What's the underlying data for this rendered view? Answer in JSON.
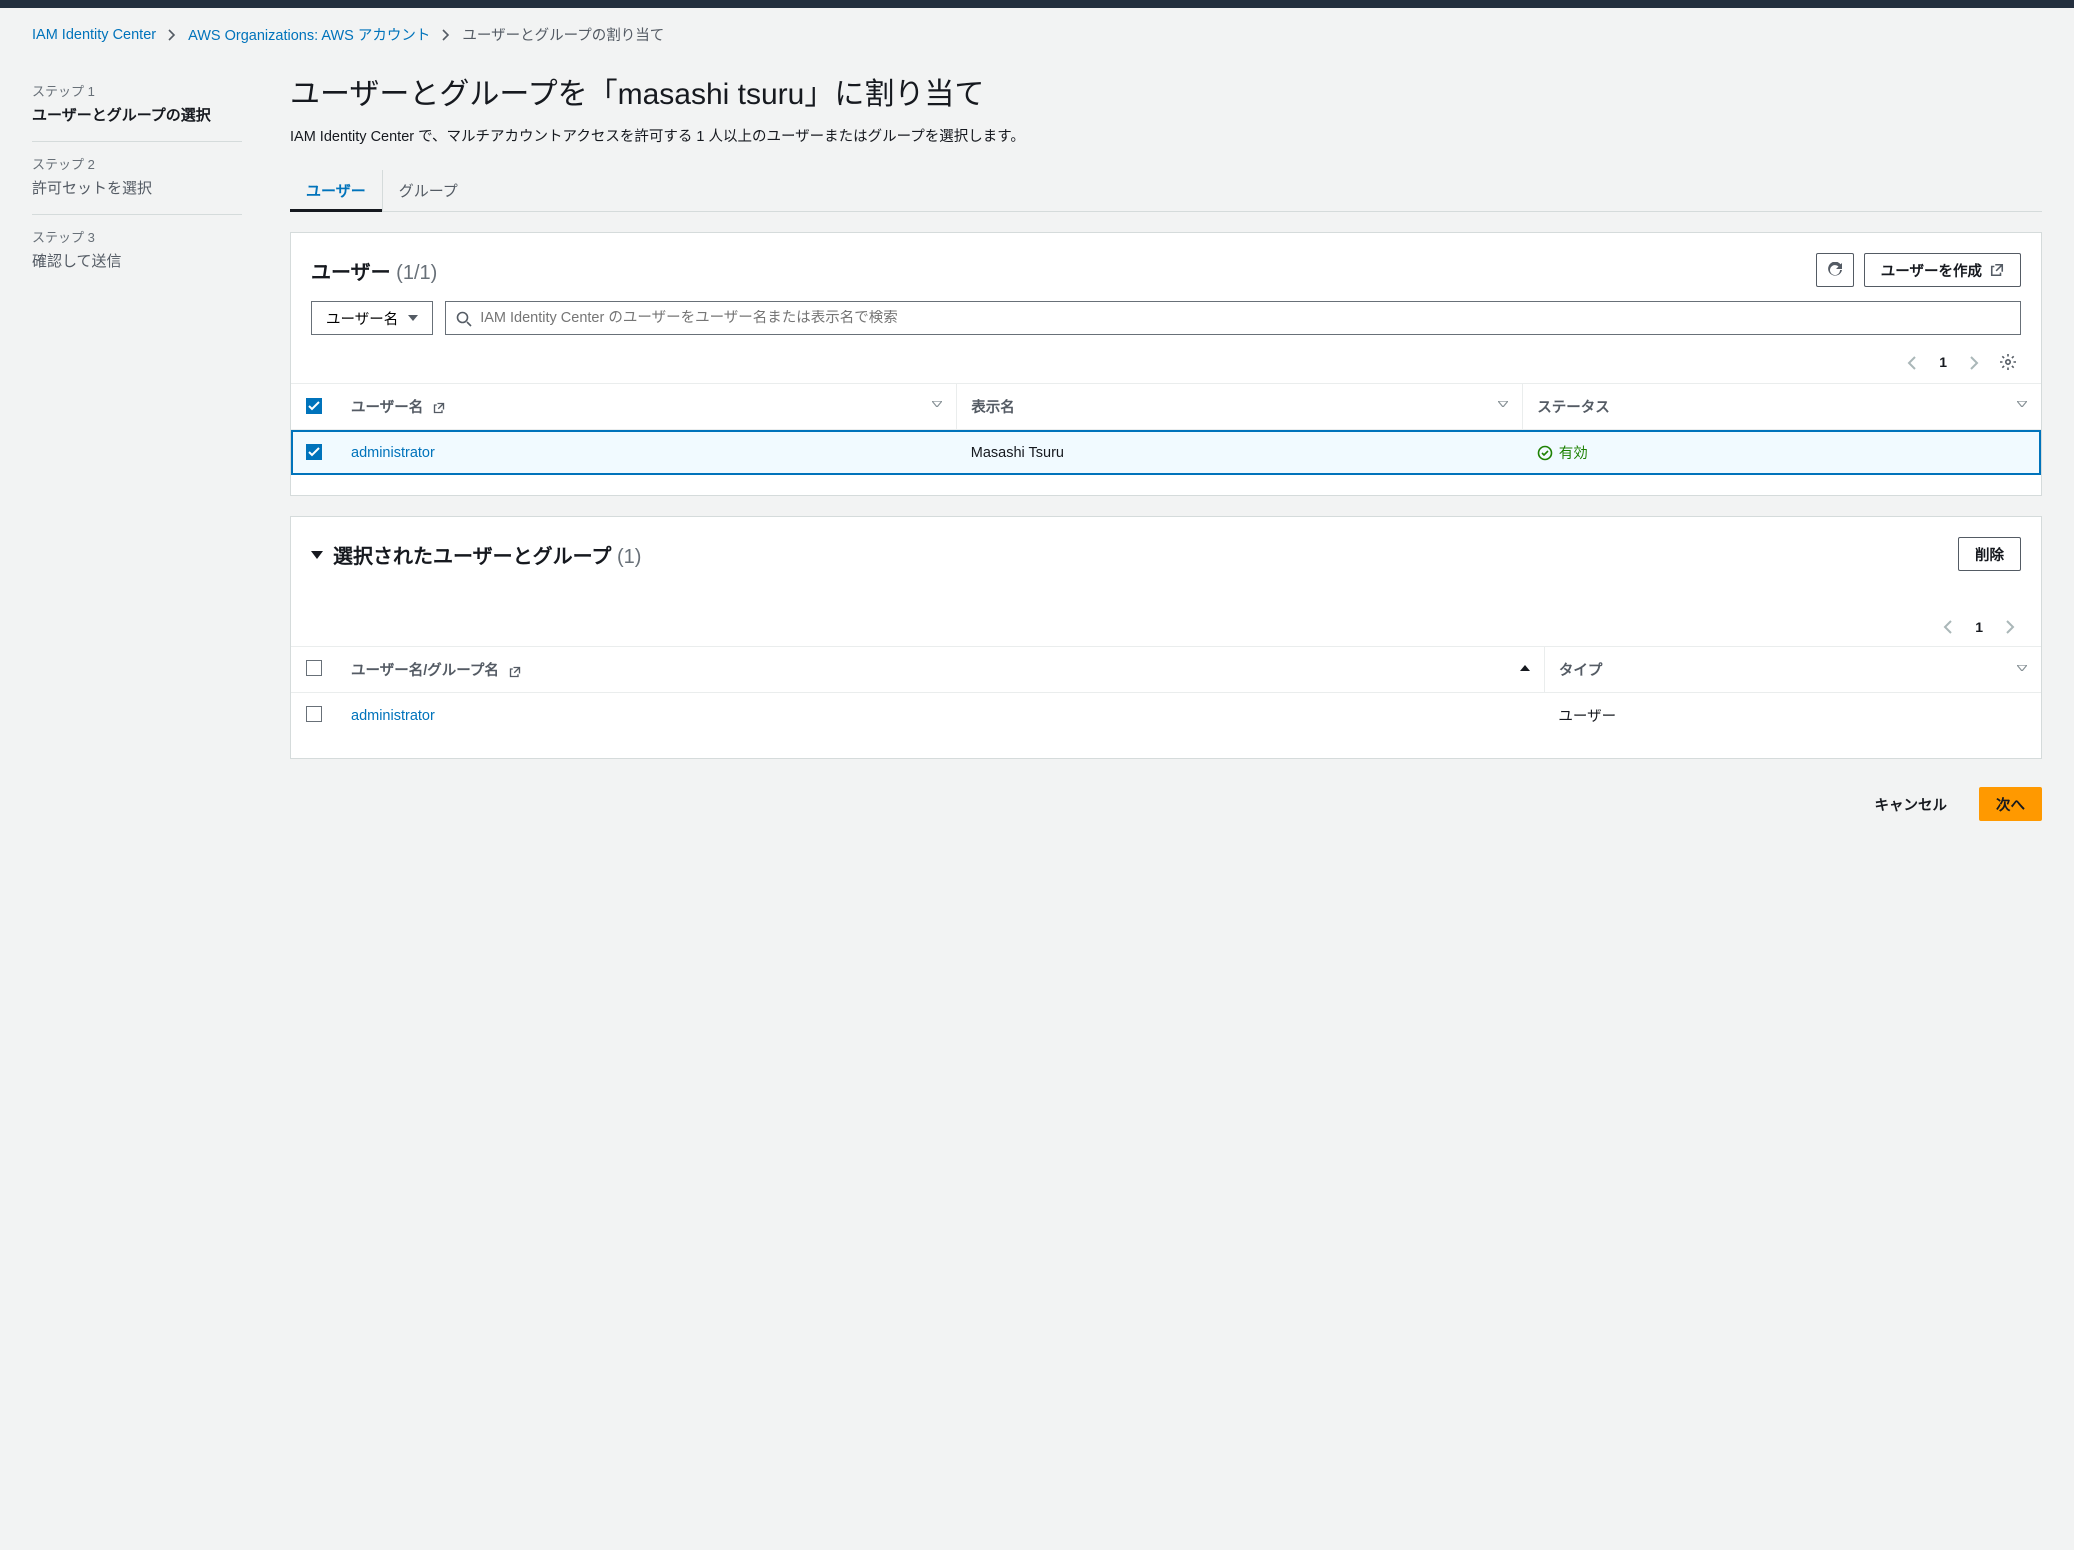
{
  "breadcrumb": {
    "item1": "IAM Identity Center",
    "item2": "AWS Organizations: AWS アカウント",
    "current": "ユーザーとグループの割り当て"
  },
  "sidebar": {
    "steps": [
      {
        "label": "ステップ 1",
        "title": "ユーザーとグループの選択"
      },
      {
        "label": "ステップ 2",
        "title": "許可セットを選択"
      },
      {
        "label": "ステップ 3",
        "title": "確認して送信"
      }
    ]
  },
  "page": {
    "title": "ユーザーとグループを「masashi tsuru」に割り当て",
    "description": "IAM Identity Center で、マルチアカウントアクセスを許可する 1 人以上のユーザーまたはグループを選択します。"
  },
  "tabs": {
    "users": "ユーザー",
    "groups": "グループ"
  },
  "users_panel": {
    "title": "ユーザー",
    "count": "(1/1)",
    "create_button": "ユーザーを作成",
    "filter_label": "ユーザー名",
    "search_placeholder": "IAM Identity Center のユーザーをユーザー名または表示名で検索",
    "page": "1",
    "columns": {
      "username": "ユーザー名",
      "displayname": "表示名",
      "status": "ステータス"
    },
    "rows": [
      {
        "username": "administrator",
        "displayname": "Masashi Tsuru",
        "status": "有効"
      }
    ]
  },
  "selected_panel": {
    "title": "選択されたユーザーとグループ",
    "count": "(1)",
    "delete_button": "削除",
    "page": "1",
    "columns": {
      "name": "ユーザー名/グループ名",
      "type": "タイプ"
    },
    "rows": [
      {
        "name": "administrator",
        "type": "ユーザー"
      }
    ]
  },
  "footer": {
    "cancel": "キャンセル",
    "next": "次へ"
  }
}
